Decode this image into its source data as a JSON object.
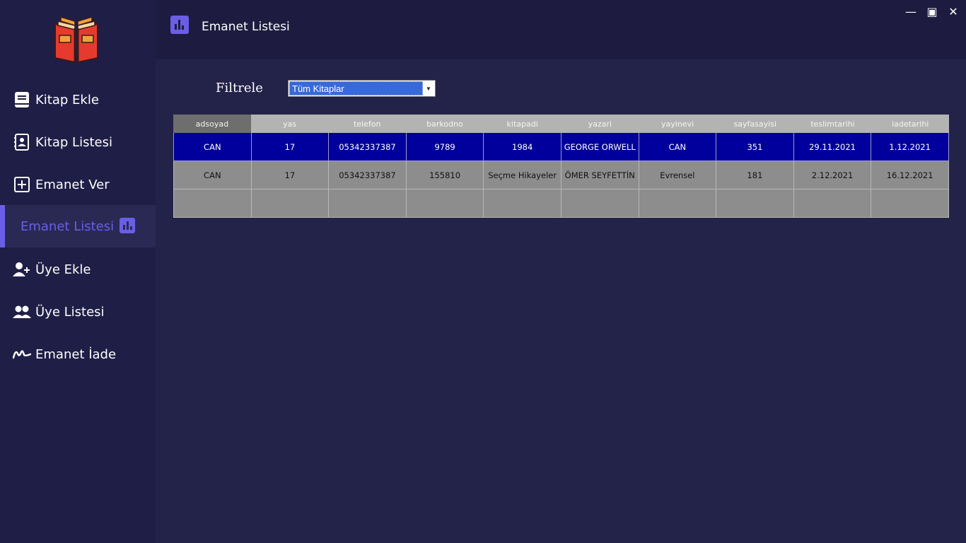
{
  "window": {
    "minimize": "—",
    "maximize": "▣",
    "close": "✕"
  },
  "header": {
    "title": "Emanet Listesi"
  },
  "sidebar": {
    "items": [
      {
        "label": "Kitap Ekle",
        "icon": "book-icon"
      },
      {
        "label": "Kitap Listesi",
        "icon": "contact-book-icon"
      },
      {
        "label": "Emanet Ver",
        "icon": "plus-square-icon"
      },
      {
        "label": "Emanet Listesi",
        "icon": "chart-icon",
        "active": true
      },
      {
        "label": "Üye Ekle",
        "icon": "user-plus-icon"
      },
      {
        "label": "Üye Listesi",
        "icon": "users-icon"
      },
      {
        "label": "Emanet İade",
        "icon": "signature-icon"
      }
    ]
  },
  "filter": {
    "label": "Filtrele",
    "selected": "Tüm Kitaplar"
  },
  "table": {
    "columns": [
      "adsoyad",
      "yas",
      "telefon",
      "barkodno",
      "kitapadi",
      "yazari",
      "yayinevi",
      "sayfasayisi",
      "teslimtarihi",
      "iadetarihi"
    ],
    "rows": [
      [
        "CAN",
        "17",
        "05342337387",
        "9789",
        "1984",
        "GEORGE ORWELL",
        "CAN",
        "351",
        "29.11.2021",
        "1.12.2021"
      ],
      [
        "CAN",
        "17",
        "05342337387",
        "155810",
        "Seçme Hikayeler",
        "ÖMER SEYFETTİN",
        "Evrensel",
        "181",
        "2.12.2021",
        "16.12.2021"
      ]
    ]
  },
  "colors": {
    "accent": "#6a5ee6",
    "selected_row": "#02009c"
  }
}
